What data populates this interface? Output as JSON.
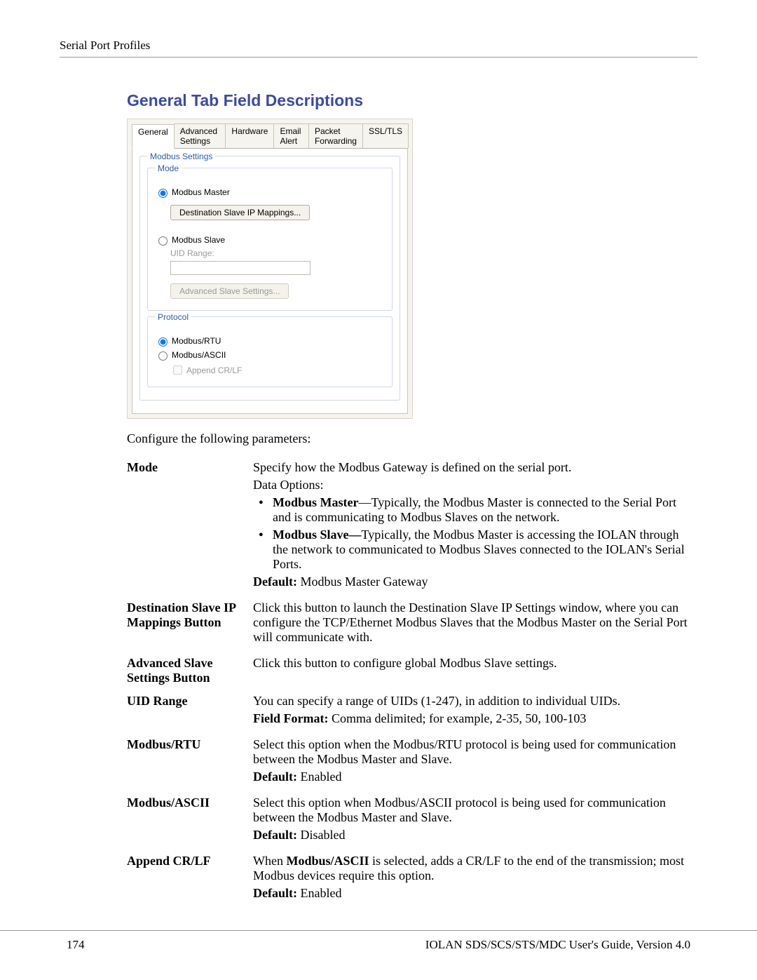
{
  "header": {
    "running": "Serial Port Profiles"
  },
  "section": {
    "title": "General Tab Field Descriptions"
  },
  "dialog": {
    "tabs": [
      "General",
      "Advanced Settings",
      "Hardware",
      "Email Alert",
      "Packet Forwarding",
      "SSL/TLS"
    ],
    "modbus_settings_legend": "Modbus Settings",
    "mode_legend": "Mode",
    "radio_master": "Modbus Master",
    "radio_slave": "Modbus Slave",
    "btn_dest_slave": "Destination Slave IP Mappings...",
    "uid_label": "UID Range:",
    "btn_adv_slave": "Advanced Slave Settings...",
    "protocol_legend": "Protocol",
    "radio_rtu": "Modbus/RTU",
    "radio_ascii": "Modbus/ASCII",
    "chk_append": "Append CR/LF"
  },
  "lead": "Configure the following parameters:",
  "rows": {
    "mode": {
      "term": "Mode",
      "p1": "Specify how the Modbus Gateway is defined on the serial port.",
      "p2": "Data Options:",
      "b1_bold": "Modbus Master",
      "b1_rest": "—Typically, the Modbus Master is connected to the Serial Port and is communicating to Modbus Slaves on the network.",
      "b2_bold": "Modbus Slave—",
      "b2_rest": "Typically, the Modbus Master is accessing the IOLAN through the network to communicated to Modbus Slaves connected to the IOLAN's Serial Ports.",
      "def_label": "Default:",
      "def_val": " Modbus Master Gateway"
    },
    "dest": {
      "term": "Destination Slave IP Mappings Button",
      "p1": "Click this button to launch the Destination Slave IP Settings window, where you can configure the TCP/Ethernet Modbus Slaves that the Modbus Master on the Serial Port will communicate with."
    },
    "adv": {
      "term": "Advanced Slave Settings Button",
      "p1": "Click this button to configure global Modbus Slave settings."
    },
    "uid": {
      "term": "UID Range",
      "p1": "You can specify a range of UIDs (1-247), in addition to individual UIDs.",
      "ff_label": "Field Format:",
      "ff_val": " Comma delimited; for example, 2-35, 50, 100-103"
    },
    "rtu": {
      "term": "Modbus/RTU",
      "p1": "Select this option when the Modbus/RTU protocol is being used for communication between the Modbus Master and Slave.",
      "def_label": "Default:",
      "def_val": " Enabled"
    },
    "ascii": {
      "term": "Modbus/ASCII",
      "p1": "Select this option when Modbus/ASCII protocol is being used for communication between the Modbus Master and Slave.",
      "def_label": "Default:",
      "def_val": " Disabled"
    },
    "append": {
      "term": "Append CR/LF",
      "pre": "When ",
      "bold": "Modbus/ASCII",
      "post": " is selected, adds a CR/LF to the end of the transmission; most Modbus devices require this option.",
      "def_label": "Default:",
      "def_val": " Enabled"
    }
  },
  "footer": {
    "page_no": "174",
    "guide": "IOLAN SDS/SCS/STS/MDC User's Guide, Version 4.0"
  }
}
